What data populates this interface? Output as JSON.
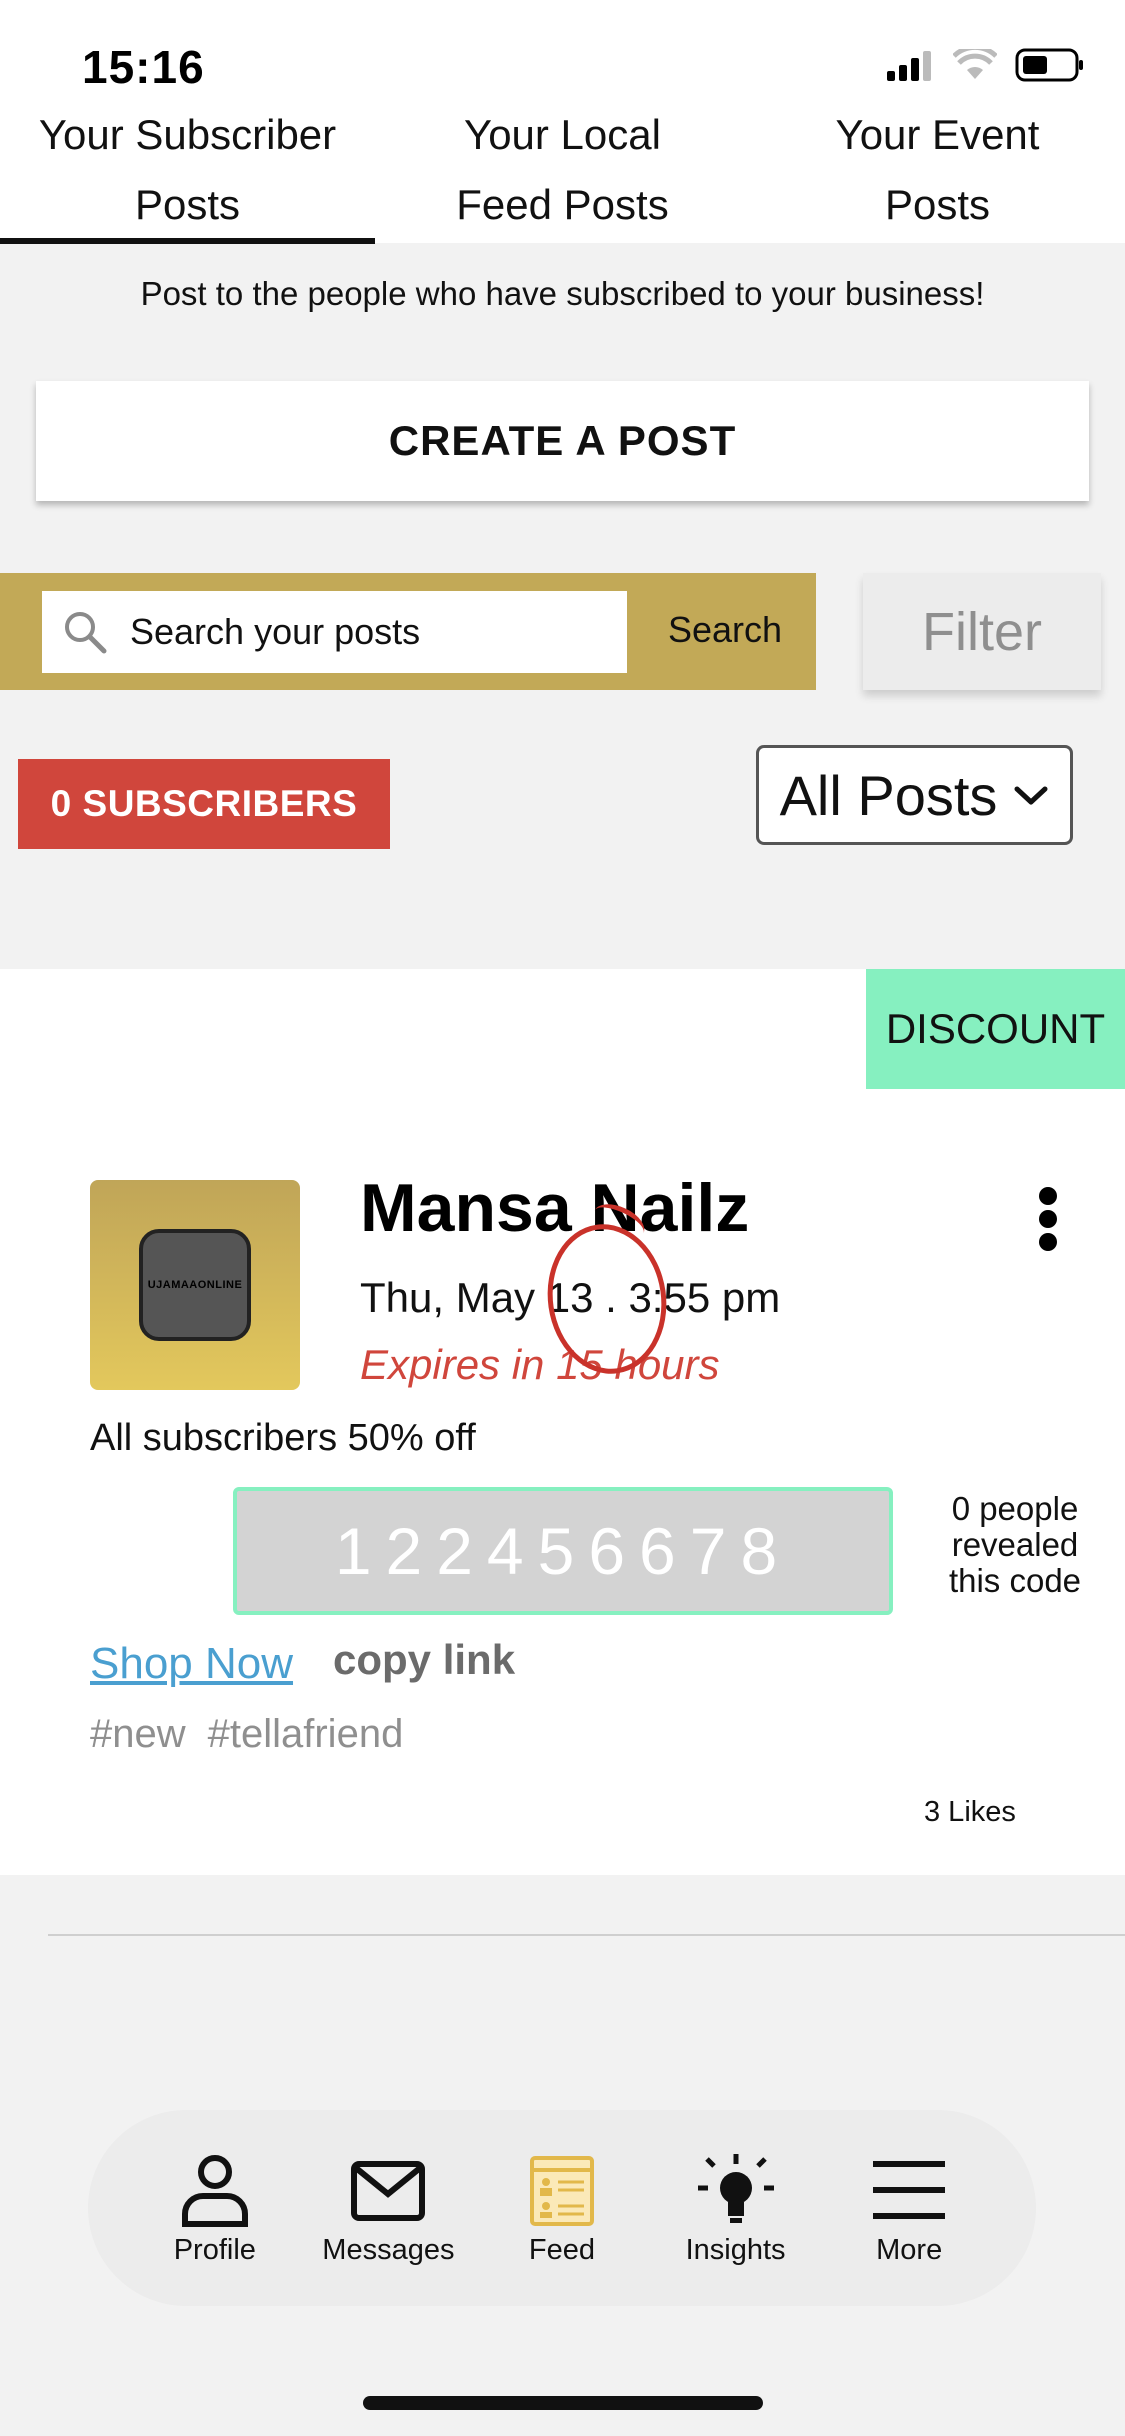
{
  "status_bar": {
    "time": "15:16"
  },
  "tabs": [
    {
      "label": "Your Subscriber Posts",
      "line1": "Your Subscriber",
      "line2": "Posts",
      "active": true
    },
    {
      "label": "Your Local Feed Posts",
      "line1": "Your Local",
      "line2": "Feed Posts",
      "active": false
    },
    {
      "label": "Your Event Posts",
      "line1": "Your Event",
      "line2": "Posts",
      "active": false
    }
  ],
  "subtitle": "Post to the people who have subscribed to your business!",
  "create_button": "CREATE A POST",
  "search": {
    "placeholder": "Search your posts",
    "button": "Search"
  },
  "filter_button": "Filter",
  "subscribers_badge": "0 SUBSCRIBERS",
  "posts_select": {
    "selected": "All Posts"
  },
  "post": {
    "tag": "DISCOUNT",
    "logo_text": "UJAMAAONLINE",
    "business_name": "Mansa Nailz",
    "date": "Thu, May 13 . 3:55 pm",
    "expires": "Expires in 15 hours",
    "offer": "All subscribers 50% off",
    "code": "122456678",
    "revealed": "0 people revealed this code",
    "shop_now": "Shop Now",
    "copy_link": "copy link",
    "tags": [
      "#new",
      "#tellafriend"
    ],
    "likes": "3 Likes"
  },
  "bottom_nav": [
    {
      "label": "Profile",
      "icon": "person-icon"
    },
    {
      "label": "Messages",
      "icon": "envelope-icon"
    },
    {
      "label": "Feed",
      "icon": "feed-icon"
    },
    {
      "label": "Insights",
      "icon": "lightbulb-icon"
    },
    {
      "label": "More",
      "icon": "menu-icon"
    }
  ],
  "colors": {
    "gold": "#c2a957",
    "red": "#d0463c",
    "mint": "#86f0c0",
    "link": "#4a9fd0"
  }
}
